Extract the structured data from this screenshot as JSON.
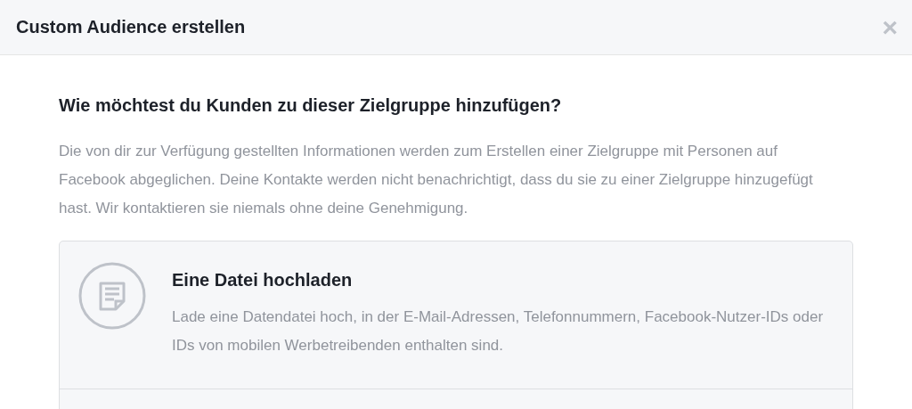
{
  "dialog": {
    "title": "Custom Audience erstellen",
    "close": "×"
  },
  "question": "Wie möchtest du Kunden zu dieser Zielgruppe hinzufügen?",
  "intro": "Die von dir zur Verfügung gestellten Informationen werden zum Erstellen einer Zielgruppe mit Personen auf Facebook abgeglichen. Deine Kontakte werden nicht benachrichtigt, dass du sie zu einer Zielgruppe hinzugefügt hast. Wir kontaktieren sie niemals ohne deine Genehmigung.",
  "options": [
    {
      "kind": "file",
      "title": "Eine Datei hochladen",
      "description": "Lade eine Datendatei hoch, in der E-Mail-Adressen, Telefonnummern, Facebook-Nutzer-IDs oder IDs von mobilen Werbetreibenden enthalten sind."
    }
  ]
}
